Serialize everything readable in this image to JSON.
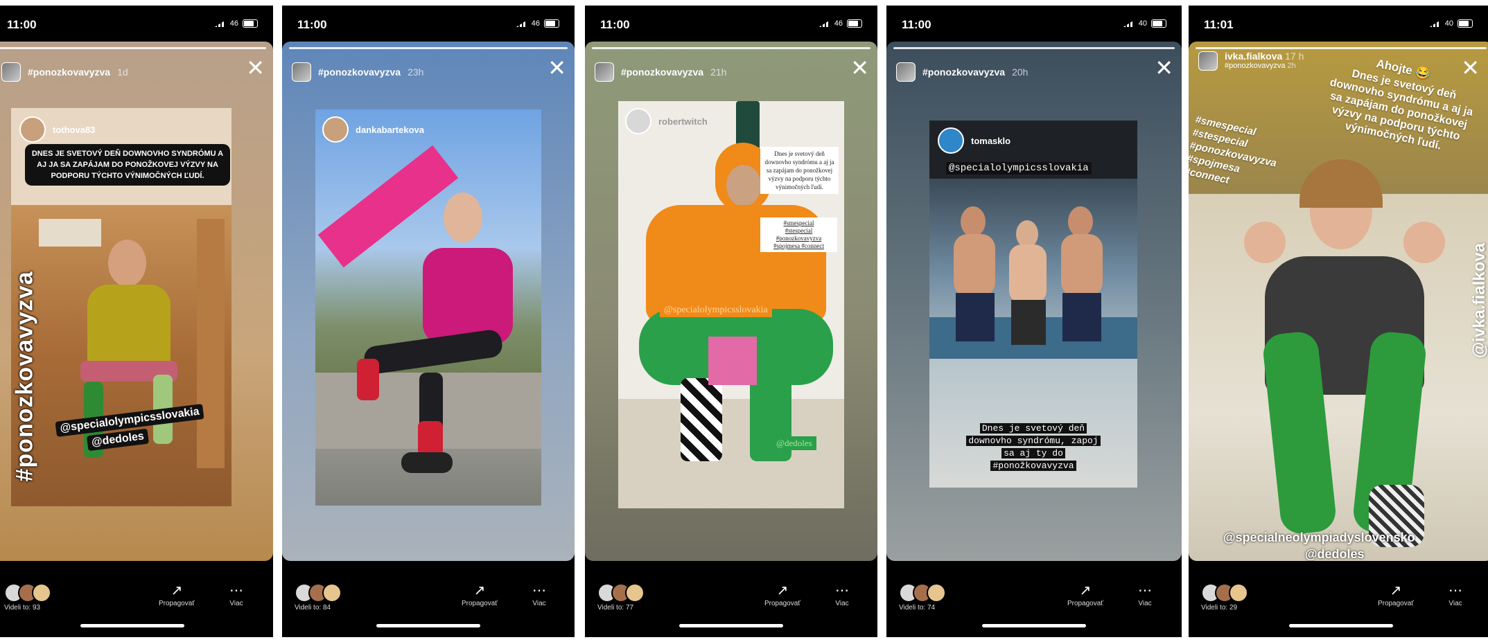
{
  "stories": [
    {
      "time": "11:00",
      "network": "46",
      "hashtag": "#ponozkovavyzva",
      "age": "1d",
      "bg": "linear-gradient(180deg,#b7a08a 0%,#c9a57a 60%,#b7894e 100%)",
      "post_handle": "tothova83",
      "caption": "DNES JE SVETOVÝ DEŇ DOWNOVHO SYNDRÓMU A AJ JA SA ZAPÁJAM DO PONOŽKOVEJ VÝZVY NA PODPORU TÝCHTO VÝNIMOČNÝCH ĽUDÍ.",
      "vertical_tag": "#ponozkovavyzva",
      "mention1": "@specialolympicsslovakia",
      "mention2": "@dedoles",
      "seen": "Videli to: 93",
      "promote": "Propagovať",
      "more": "Viac"
    },
    {
      "time": "11:00",
      "network": "46",
      "hashtag": "#ponozkovavyzva",
      "age": "23h",
      "bg": "linear-gradient(180deg,#5f86b9 0%,#8fa6c2 55%,#aab2ba 100%)",
      "post_handle": "dankabartekova",
      "seen": "Videli to: 84",
      "promote": "Propagovať",
      "more": "Viac"
    },
    {
      "time": "11:00",
      "network": "46",
      "hashtag": "#ponozkovavyzva",
      "age": "21h",
      "bg": "linear-gradient(180deg,#8f9a7a 0%,#8a8a72 55%,#6e6d5f 100%)",
      "post_handle": "robertwitch",
      "caption": "Dnes je svetový deň downovho syndrómu a aj ja sa zapájam do ponožkovej výzvy na podporu týchto výnimočných ľudí.",
      "tags": [
        "#smespecial",
        "#stespecial",
        "#ponozkovavyzva",
        "#spojmesa #connect"
      ],
      "mention1": "@specialolympicsslovakia",
      "mention2": "@dedoles",
      "seen": "Videli to: 77",
      "promote": "Propagovať",
      "more": "Viac"
    },
    {
      "time": "11:00",
      "network": "40",
      "hashtag": "#ponozkovavyzva",
      "age": "20h",
      "bg": "linear-gradient(180deg,#3c4d5c 0%,#6b7a82 55%,#9aa0a0 100%)",
      "post_handle": "tomasklo",
      "mention1": "@specialolympicsslovakia",
      "caption_lines": [
        "Dnes je svetový deň",
        "downovho syndrómu, zapoj",
        "sa aj ty do",
        "#ponožkovavyzva"
      ],
      "seen": "Videli to: 74",
      "promote": "Propagovať",
      "more": "Viac"
    },
    {
      "time": "11:01",
      "network": "40",
      "username": "ivka.fialkova",
      "age": "17 h",
      "hashtag": "#ponozkovavyzva",
      "age2": "2h",
      "bg": "linear-gradient(180deg,#b79a40 0%,#8c7b52 45%,#6c5a3e 100%)",
      "greeting": "Ahojte 😂",
      "caption_lines": [
        "Dnes je svetový deň",
        "downovho syndrómu a aj ja",
        "sa zapájam do ponožkovej",
        "výzvy na podporu týchto",
        "výnimočných ľudí."
      ],
      "tags": [
        "#smespecial",
        "#stespecial",
        "#ponozkovavyzva",
        "#spojmesa",
        "#connect"
      ],
      "vertical_tag": "@ivka.fialkova",
      "mention1": "@specialneolympiadyslovensko",
      "mention2": "@dedoles",
      "seen": "Videli to: 29",
      "promote": "Propagovať",
      "more": "Viac"
    }
  ]
}
